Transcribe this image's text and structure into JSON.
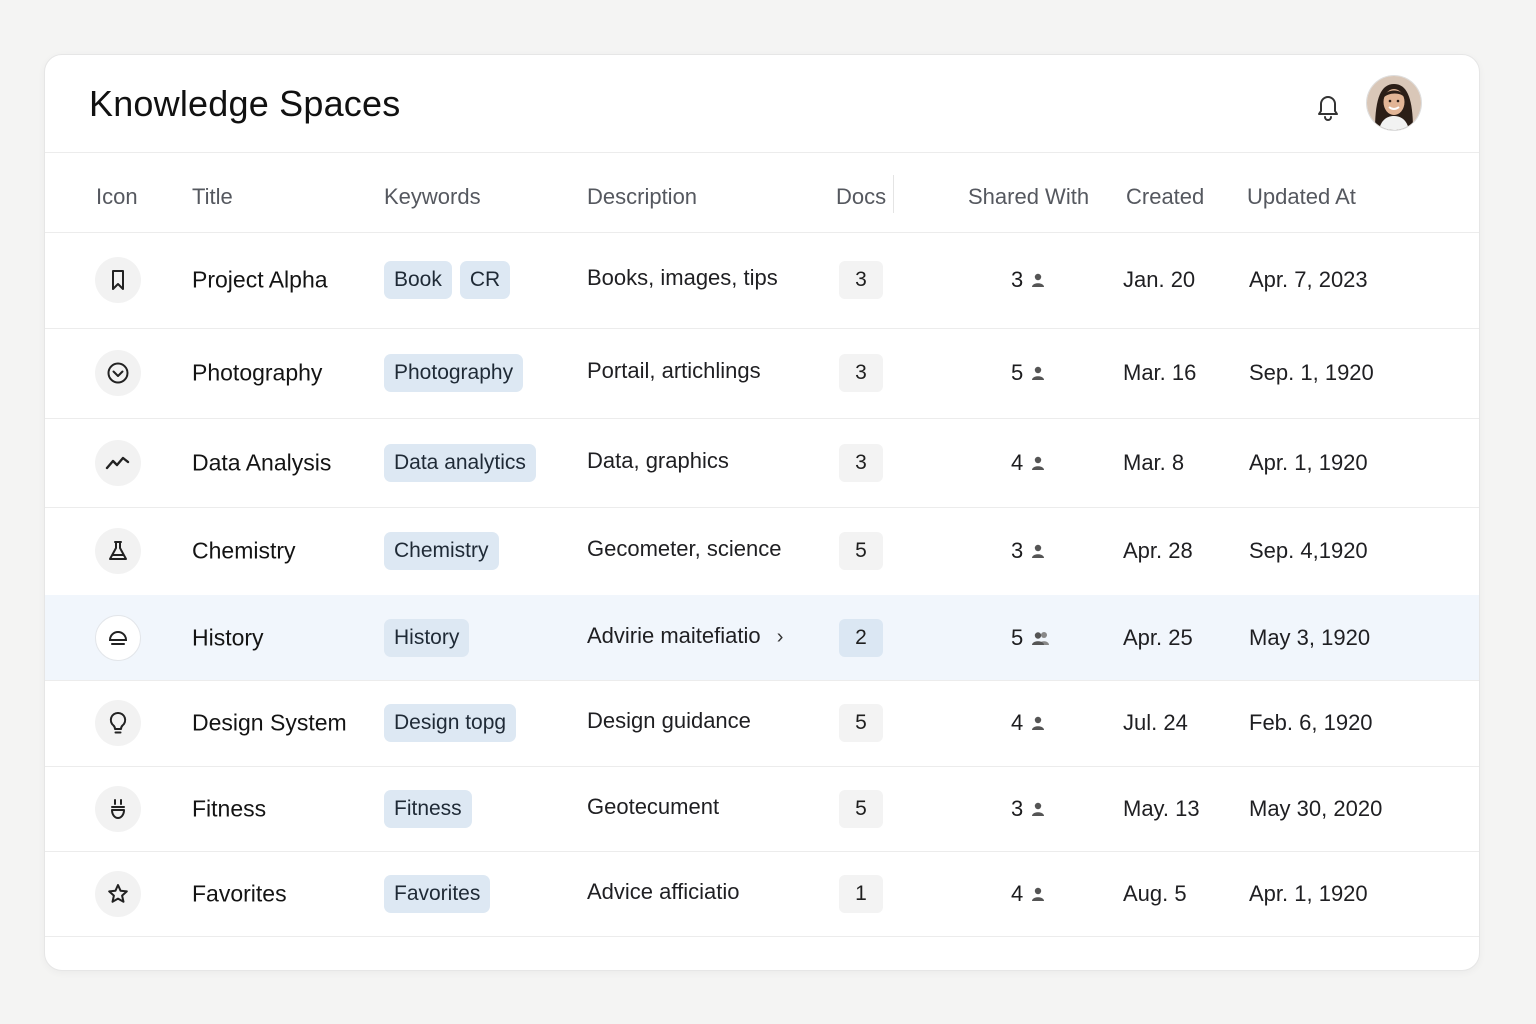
{
  "header": {
    "title": "Knowledge Spaces"
  },
  "table": {
    "columns": [
      "Icon",
      "Title",
      "Keywords",
      "Description",
      "Docs",
      "Shared With",
      "Created",
      "Updated At"
    ],
    "rows": [
      {
        "icon": "bookmark-icon",
        "title": "Project Alpha",
        "keywords": [
          "Book",
          "CR"
        ],
        "description": "Books, images, tips",
        "docs": "3",
        "shared": "3",
        "created": "Jan. 20",
        "updated": "Apr. 7, 2023"
      },
      {
        "icon": "chevron-circle-icon",
        "title": "Photography",
        "keywords": [
          "Photography"
        ],
        "description": "Portail, artichlings",
        "docs": "3",
        "shared": "5",
        "created": "Mar. 16",
        "updated": "Sep. 1, 1920"
      },
      {
        "icon": "trend-line-icon",
        "title": "Data Analysis",
        "keywords": [
          "Data analytics"
        ],
        "description": "Data, graphics",
        "docs": "3",
        "shared": "4",
        "created": "Mar. 8",
        "updated": "Apr. 1, 1920"
      },
      {
        "icon": "flask-icon",
        "title": "Chemistry",
        "keywords": [
          "Chemistry"
        ],
        "description": "Gecometer, science",
        "docs": "5",
        "shared": "3",
        "created": "Apr. 28",
        "updated": "Sep. 4,1920"
      },
      {
        "icon": "dome-icon",
        "title": "History",
        "keywords": [
          "History"
        ],
        "description": "Advirie maitefiatio",
        "docs": "2",
        "shared": "5",
        "created": "Apr. 25",
        "updated": "May 3, 1920"
      },
      {
        "icon": "lightbulb-icon",
        "title": "Design System",
        "keywords": [
          "Design topg"
        ],
        "description": "Design guidance",
        "docs": "5",
        "shared": "4",
        "created": "Jul. 24",
        "updated": "Feb. 6, 1920"
      },
      {
        "icon": "dumbbell-icon",
        "title": "Fitness",
        "keywords": [
          "Fitness"
        ],
        "description": "Geotecument",
        "docs": "5",
        "shared": "3",
        "created": "May. 13",
        "updated": "May 30, 2020"
      },
      {
        "icon": "star-icon",
        "title": "Favorites",
        "keywords": [
          "Favorites"
        ],
        "description": "Advice afficiatio",
        "docs": "1",
        "shared": "4",
        "created": "Aug. 5",
        "updated": "Apr. 1, 1920"
      }
    ]
  },
  "colors": {
    "accent_tag": "#dde8f3",
    "selected_row": "#f1f6fc",
    "background": "#f4f4f3"
  }
}
